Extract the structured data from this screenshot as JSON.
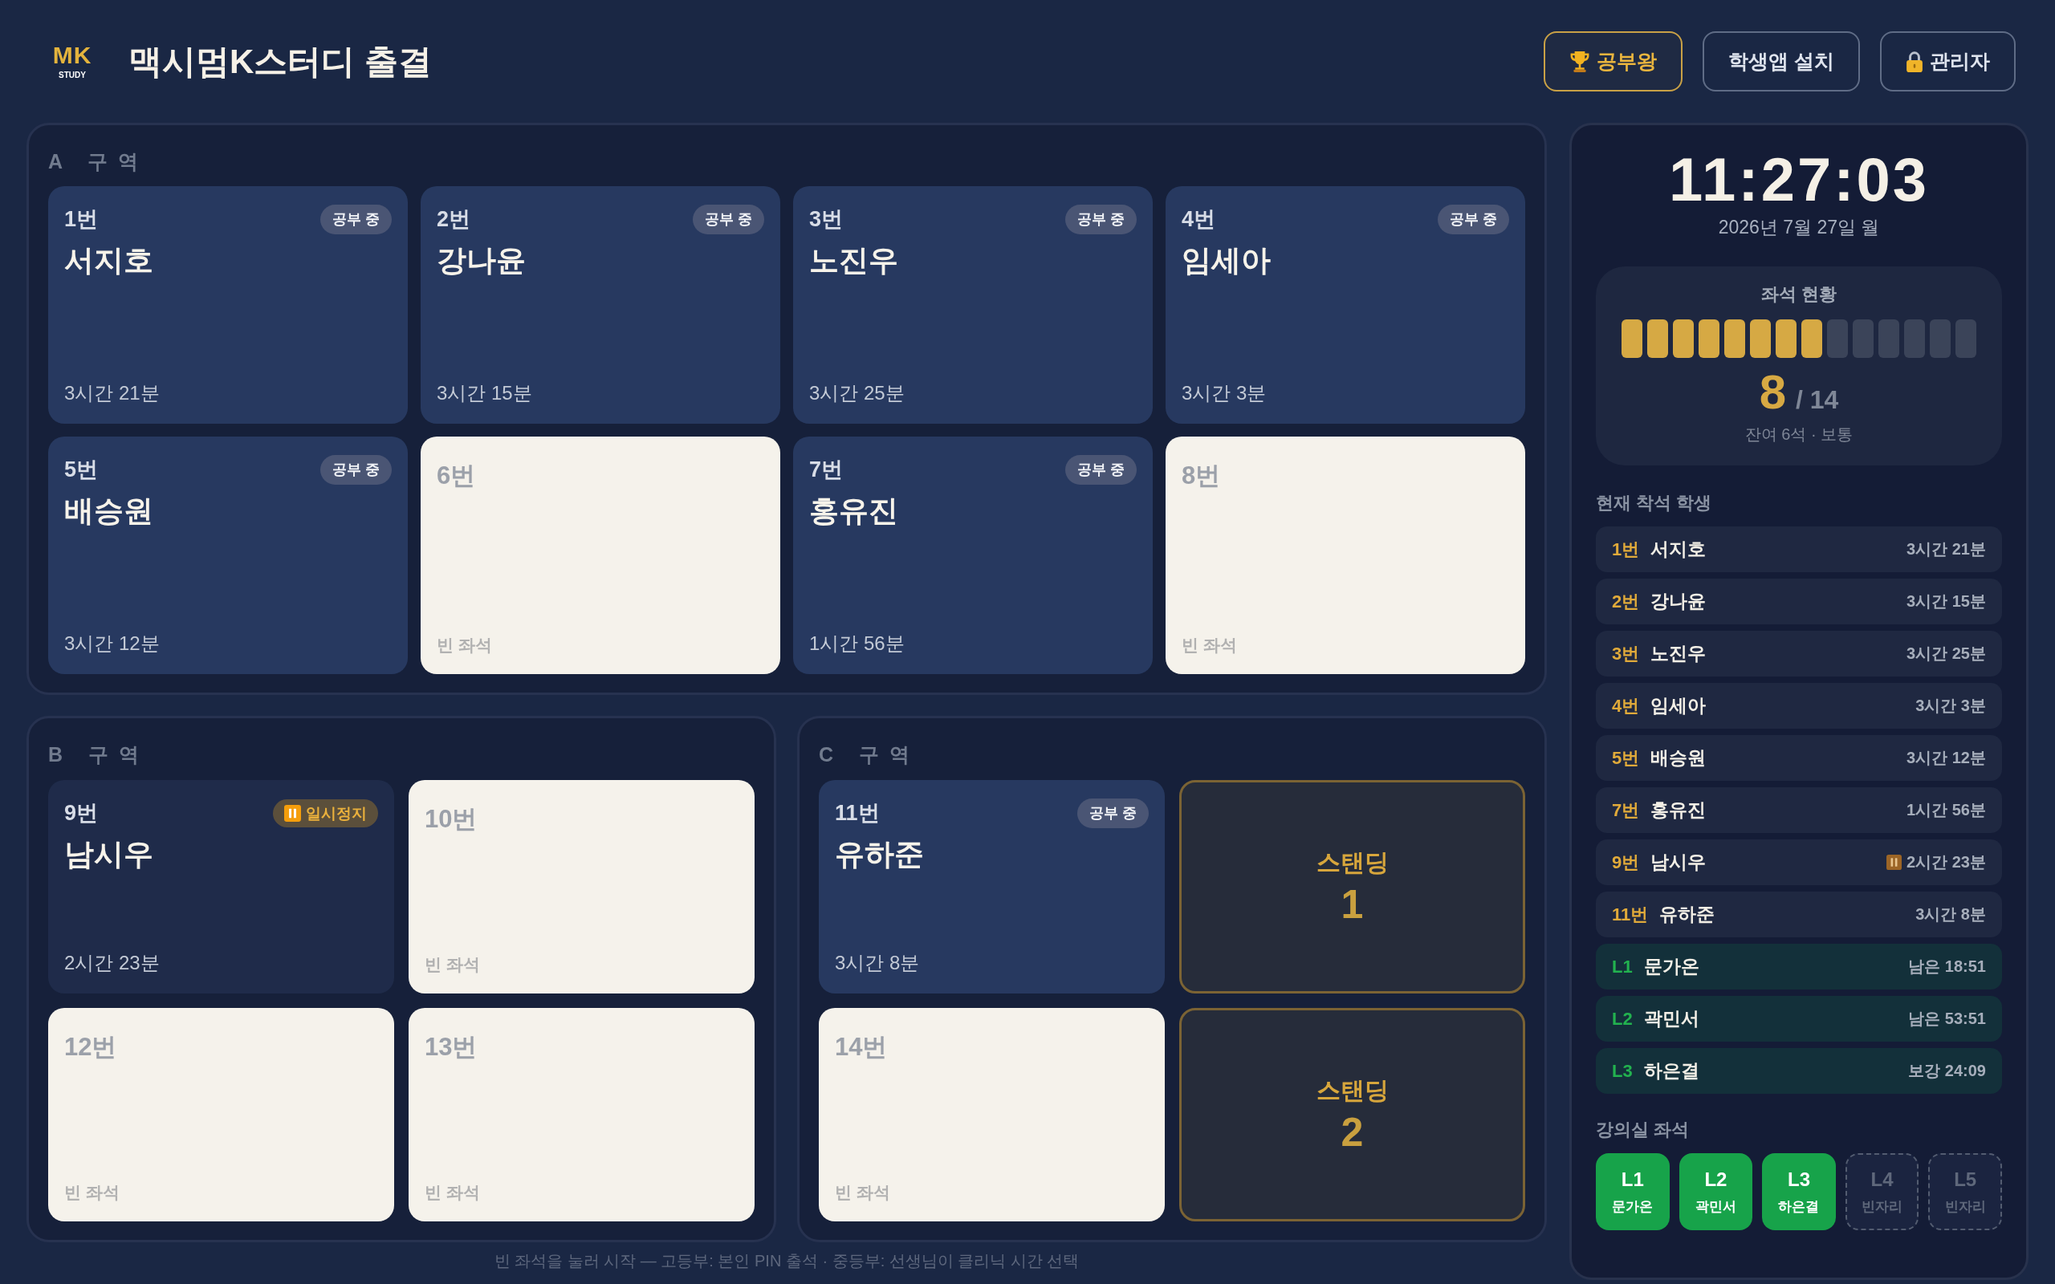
{
  "header": {
    "logo": {
      "mark": "MK",
      "subtext": "STUDY"
    },
    "title": "맥시멈K스터디 출결",
    "buttons": [
      {
        "kind": "ranking",
        "label": "공부왕"
      },
      {
        "kind": "install",
        "label": "학생앱 설치"
      },
      {
        "kind": "admin",
        "label": "관리자"
      }
    ]
  },
  "zones": [
    {
      "label": "A 구역",
      "seats": [
        {
          "kind": "occupied",
          "number": "1번",
          "name": "서지호",
          "status": "공부 중",
          "time": "3시간 21분"
        },
        {
          "kind": "occupied",
          "number": "2번",
          "name": "강나윤",
          "status": "공부 중",
          "time": "3시간 15분"
        },
        {
          "kind": "occupied",
          "number": "3번",
          "name": "노진우",
          "status": "공부 중",
          "time": "3시간 25분"
        },
        {
          "kind": "occupied",
          "number": "4번",
          "name": "임세아",
          "status": "공부 중",
          "time": "3시간 3분"
        },
        {
          "kind": "occupied",
          "number": "5번",
          "name": "배승원",
          "status": "공부 중",
          "time": "3시간 12분"
        },
        {
          "kind": "empty",
          "number": "6번",
          "note": "빈 좌석"
        },
        {
          "kind": "occupied",
          "number": "7번",
          "name": "홍유진",
          "status": "공부 중",
          "time": "1시간 56분"
        },
        {
          "kind": "empty",
          "number": "8번",
          "note": "빈 좌석"
        }
      ]
    },
    {
      "label": "B 구역",
      "seats": [
        {
          "kind": "paused",
          "number": "9번",
          "name": "남시우",
          "status": "일시정지",
          "time": "2시간 23분"
        },
        {
          "kind": "empty",
          "number": "10번",
          "note": "빈 좌석"
        },
        {
          "kind": "empty",
          "number": "12번",
          "note": "빈 좌석"
        },
        {
          "kind": "empty",
          "number": "13번",
          "note": "빈 좌석"
        }
      ]
    },
    {
      "label": "C 구역",
      "seats": [
        {
          "kind": "occupied",
          "number": "11번",
          "name": "유하준",
          "status": "공부 중",
          "time": "3시간 8분"
        },
        {
          "kind": "standing",
          "label": "스탠딩",
          "number": "1"
        },
        {
          "kind": "empty",
          "number": "14번",
          "note": "빈 좌석"
        },
        {
          "kind": "standing",
          "label": "스탠딩",
          "number": "2"
        }
      ]
    }
  ],
  "footer_note": "빈 좌석을 눌러 시작 — 고등부: 본인 PIN 출석 · 중등부: 선생님이 클리닉 시간 선택",
  "side_panel": {
    "clock": "11:27:03",
    "date": "2026년 7월 27일 월",
    "occupancy": {
      "title": "좌석 현황",
      "slots": [
        {
          "filled": true
        },
        {
          "filled": true
        },
        {
          "filled": true
        },
        {
          "filled": true
        },
        {
          "filled": true
        },
        {
          "filled": true
        },
        {
          "filled": true
        },
        {
          "filled": true
        },
        {
          "filled": false
        },
        {
          "filled": false
        },
        {
          "filled": false
        },
        {
          "filled": false
        },
        {
          "filled": false
        },
        {
          "filled": false
        }
      ],
      "count": "8",
      "total": "/ 14",
      "remaining": "잔여 6석 · 보통"
    },
    "current_title": "현재 착석 학생",
    "current": [
      {
        "kind": "seat",
        "seat": "1번",
        "name": "서지호",
        "time": "3시간 21분",
        "paused": false
      },
      {
        "kind": "seat",
        "seat": "2번",
        "name": "강나윤",
        "time": "3시간 15분",
        "paused": false
      },
      {
        "kind": "seat",
        "seat": "3번",
        "name": "노진우",
        "time": "3시간 25분",
        "paused": false
      },
      {
        "kind": "seat",
        "seat": "4번",
        "name": "임세아",
        "time": "3시간 3분",
        "paused": false
      },
      {
        "kind": "seat",
        "seat": "5번",
        "name": "배승원",
        "time": "3시간 12분",
        "paused": false
      },
      {
        "kind": "seat",
        "seat": "7번",
        "name": "홍유진",
        "time": "1시간 56분",
        "paused": false
      },
      {
        "kind": "seat",
        "seat": "9번",
        "name": "남시우",
        "time": "2시간 23분",
        "paused": true
      },
      {
        "kind": "seat",
        "seat": "11번",
        "name": "유하준",
        "time": "3시간 8분",
        "paused": false
      },
      {
        "kind": "lecture",
        "seat": "L1",
        "name": "문가온",
        "time": "남은 18:51",
        "paused": false
      },
      {
        "kind": "lecture",
        "seat": "L2",
        "name": "곽민서",
        "time": "남은 53:51",
        "paused": false
      },
      {
        "kind": "lecture",
        "seat": "L3",
        "name": "하은결",
        "time": "보강 24:09",
        "paused": false
      }
    ],
    "lecture_title": "강의실 좌석",
    "lecture_seats": [
      {
        "seat": "L1",
        "name": "문가온",
        "occupied": true
      },
      {
        "seat": "L2",
        "name": "곽민서",
        "occupied": true
      },
      {
        "seat": "L3",
        "name": "하은결",
        "occupied": true
      },
      {
        "seat": "L4",
        "name": "빈자리",
        "occupied": false
      },
      {
        "seat": "L5",
        "name": "빈자리",
        "occupied": false
      }
    ]
  }
}
